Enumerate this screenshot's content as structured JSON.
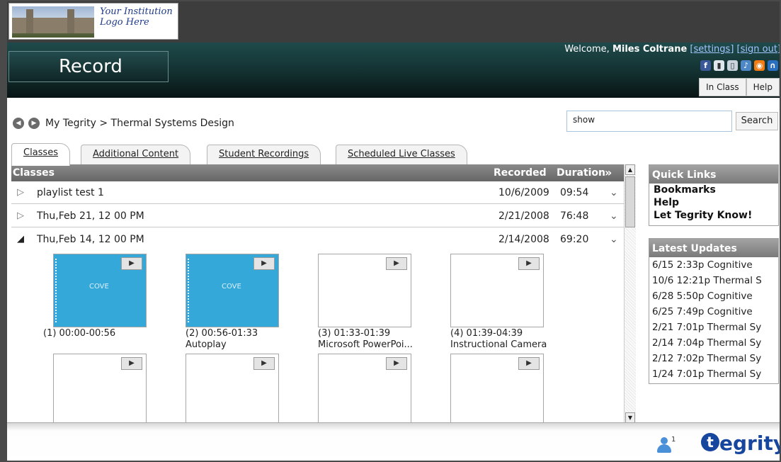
{
  "logo": {
    "line1": "Your Institution",
    "line2": "Logo Here"
  },
  "header": {
    "title": "Record",
    "welcome_prefix": "Welcome,",
    "user_name": "Miles Coltrane",
    "settings_link": "[settings]",
    "signout_link": "[sign out]",
    "social_icons": [
      "facebook-icon",
      "mobile-icon",
      "ipod-icon",
      "itunes-icon",
      "rss-icon",
      "podcast-icon"
    ],
    "in_class_label": "In Class",
    "help_label": "Help"
  },
  "nav": {
    "breadcrumb": "My Tegrity > Thermal Systems Design",
    "search_value": "show",
    "search_button": "Search"
  },
  "tabs": [
    "Classes",
    "Additional Content",
    "Student Recordings",
    "Scheduled Live Classes"
  ],
  "table": {
    "headers": {
      "name": "Classes",
      "recorded": "Recorded",
      "duration": "Duration"
    },
    "rows": [
      {
        "title": "playlist test 1",
        "recorded": "10/6/2009",
        "duration": "09:54",
        "expanded": false
      },
      {
        "title": "Thu,Feb 21, 12 00 PM",
        "recorded": "2/21/2008",
        "duration": "76:48",
        "expanded": false
      },
      {
        "title": "Thu,Feb 14, 12 00 PM",
        "recorded": "2/14/2008",
        "duration": "69:20",
        "expanded": true
      }
    ]
  },
  "segments": [
    {
      "time": "(1) 00:00-00:56",
      "label": ""
    },
    {
      "time": "(2) 00:56-01:33",
      "label": "Autoplay"
    },
    {
      "time": "(3) 01:33-01:39",
      "label": "Microsoft PowerPoi..."
    },
    {
      "time": "(4) 01:39-04:39",
      "label": "Instructional Camera"
    }
  ],
  "thumb_text": "COVE",
  "quick_links": {
    "title": "Quick Links",
    "items": [
      "Bookmarks",
      "Help",
      "Let Tegrity Know!"
    ]
  },
  "latest_updates": {
    "title": "Latest Updates",
    "items": [
      "6/15 2:33p Cognitive",
      "10/6 12:21p Thermal S",
      "6/28 5:50p Cognitive",
      "6/25 7:49p Cognitive",
      "2/21 7:01p Thermal Sy",
      "2/14 7:04p Thermal Sy",
      "2/12 7:02p Thermal Sy",
      "1/24 7:01p Thermal Sy"
    ]
  },
  "footer": {
    "user_count": "1",
    "brand": "egrity",
    "brand_mark": "t"
  }
}
